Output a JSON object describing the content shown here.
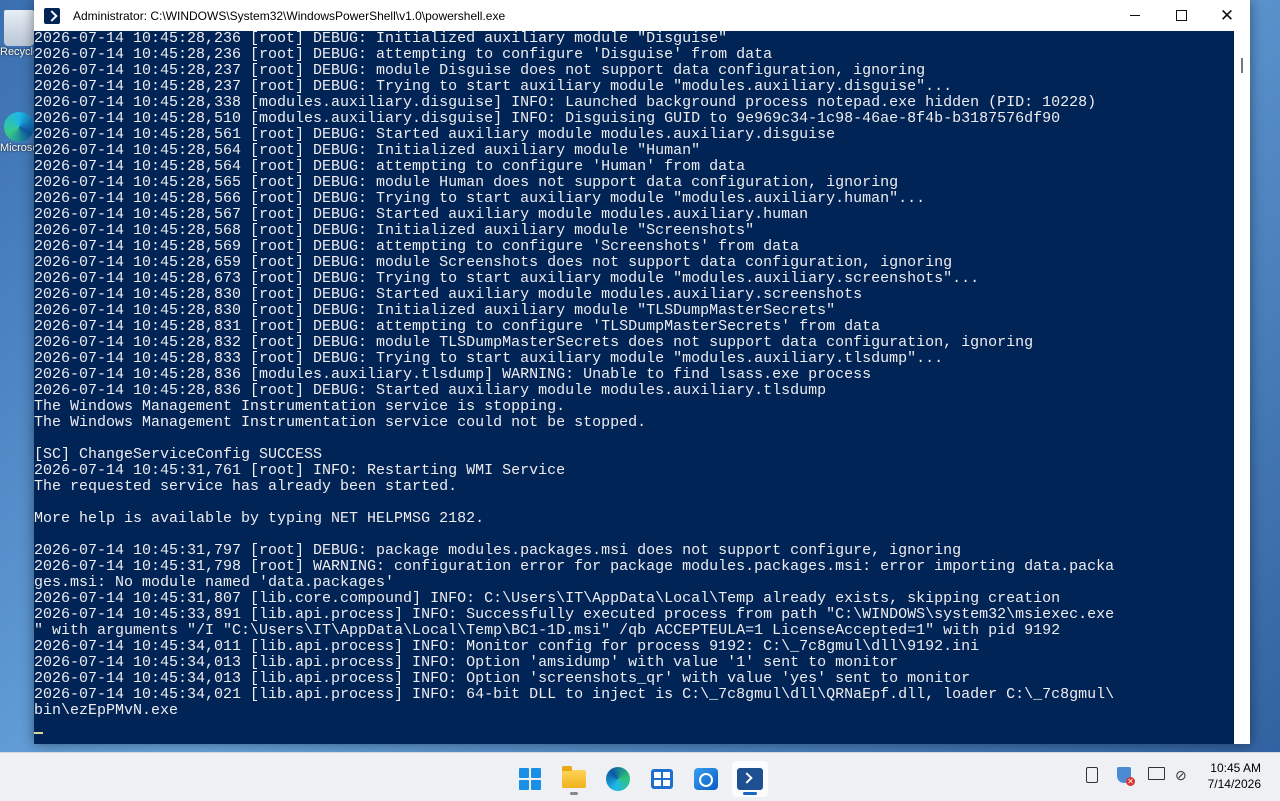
{
  "desktop": {
    "icons": [
      {
        "label": "Recycle Bin"
      },
      {
        "label": "Microsoft Edge"
      }
    ]
  },
  "window": {
    "title": "Administrator: C:\\WINDOWS\\System32\\WindowsPowerShell\\v1.0\\powershell.exe",
    "controls": {
      "minimize": "—",
      "maximize": "☐",
      "close": "✕"
    }
  },
  "console": {
    "lines": [
      "2026-07-14 10:45:28,236 [root] DEBUG: Initialized auxiliary module \"Disguise\"",
      "2026-07-14 10:45:28,236 [root] DEBUG: attempting to configure 'Disguise' from data",
      "2026-07-14 10:45:28,237 [root] DEBUG: module Disguise does not support data configuration, ignoring",
      "2026-07-14 10:45:28,237 [root] DEBUG: Trying to start auxiliary module \"modules.auxiliary.disguise\"...",
      "2026-07-14 10:45:28,338 [modules.auxiliary.disguise] INFO: Launched background process notepad.exe hidden (PID: 10228)",
      "2026-07-14 10:45:28,510 [modules.auxiliary.disguise] INFO: Disguising GUID to 9e969c34-1c98-46ae-8f4b-b3187576df90",
      "2026-07-14 10:45:28,561 [root] DEBUG: Started auxiliary module modules.auxiliary.disguise",
      "2026-07-14 10:45:28,564 [root] DEBUG: Initialized auxiliary module \"Human\"",
      "2026-07-14 10:45:28,564 [root] DEBUG: attempting to configure 'Human' from data",
      "2026-07-14 10:45:28,565 [root] DEBUG: module Human does not support data configuration, ignoring",
      "2026-07-14 10:45:28,566 [root] DEBUG: Trying to start auxiliary module \"modules.auxiliary.human\"...",
      "2026-07-14 10:45:28,567 [root] DEBUG: Started auxiliary module modules.auxiliary.human",
      "2026-07-14 10:45:28,568 [root] DEBUG: Initialized auxiliary module \"Screenshots\"",
      "2026-07-14 10:45:28,569 [root] DEBUG: attempting to configure 'Screenshots' from data",
      "2026-07-14 10:45:28,659 [root] DEBUG: module Screenshots does not support data configuration, ignoring",
      "2026-07-14 10:45:28,673 [root] DEBUG: Trying to start auxiliary module \"modules.auxiliary.screenshots\"...",
      "2026-07-14 10:45:28,830 [root] DEBUG: Started auxiliary module modules.auxiliary.screenshots",
      "2026-07-14 10:45:28,830 [root] DEBUG: Initialized auxiliary module \"TLSDumpMasterSecrets\"",
      "2026-07-14 10:45:28,831 [root] DEBUG: attempting to configure 'TLSDumpMasterSecrets' from data",
      "2026-07-14 10:45:28,832 [root] DEBUG: module TLSDumpMasterSecrets does not support data configuration, ignoring",
      "2026-07-14 10:45:28,833 [root] DEBUG: Trying to start auxiliary module \"modules.auxiliary.tlsdump\"...",
      "2026-07-14 10:45:28,836 [modules.auxiliary.tlsdump] WARNING: Unable to find lsass.exe process",
      "2026-07-14 10:45:28,836 [root] DEBUG: Started auxiliary module modules.auxiliary.tlsdump",
      "The Windows Management Instrumentation service is stopping.",
      "The Windows Management Instrumentation service could not be stopped.",
      "",
      "[SC] ChangeServiceConfig SUCCESS",
      "2026-07-14 10:45:31,761 [root] INFO: Restarting WMI Service",
      "The requested service has already been started.",
      "",
      "More help is available by typing NET HELPMSG 2182.",
      "",
      "2026-07-14 10:45:31,797 [root] DEBUG: package modules.packages.msi does not support configure, ignoring",
      "2026-07-14 10:45:31,798 [root] WARNING: configuration error for package modules.packages.msi: error importing data.packa",
      "ges.msi: No module named 'data.packages'",
      "2026-07-14 10:45:31,807 [lib.core.compound] INFO: C:\\Users\\IT\\AppData\\Local\\Temp already exists, skipping creation",
      "2026-07-14 10:45:33,891 [lib.api.process] INFO: Successfully executed process from path \"C:\\WINDOWS\\system32\\msiexec.exe",
      "\" with arguments \"/I \"C:\\Users\\IT\\AppData\\Local\\Temp\\BC1-1D.msi\" /qb ACCEPTEULA=1 LicenseAccepted=1\" with pid 9192",
      "2026-07-14 10:45:34,011 [lib.api.process] INFO: Monitor config for process 9192: C:\\_7c8gmul\\dll\\9192.ini",
      "2026-07-14 10:45:34,013 [lib.api.process] INFO: Option 'amsidump' with value '1' sent to monitor",
      "2026-07-14 10:45:34,013 [lib.api.process] INFO: Option 'screenshots_qr' with value 'yes' sent to monitor",
      "2026-07-14 10:45:34,021 [lib.api.process] INFO: 64-bit DLL to inject is C:\\_7c8gmul\\dll\\QRNaEpf.dll, loader C:\\_7c8gmul\\",
      "bin\\ezEpPMvN.exe",
      ""
    ],
    "colors": {
      "background": "#012456",
      "foreground": "#eeedf0"
    }
  },
  "taskbar": {
    "apps": [
      {
        "name": "start-button",
        "active": false
      },
      {
        "name": "file-explorer",
        "active": false
      },
      {
        "name": "edge",
        "active": false
      },
      {
        "name": "store",
        "active": false
      },
      {
        "name": "outlook",
        "active": false
      },
      {
        "name": "powershell",
        "active": true
      }
    ],
    "clock": {
      "time": "10:45 AM",
      "date": "7/14/2026"
    }
  }
}
